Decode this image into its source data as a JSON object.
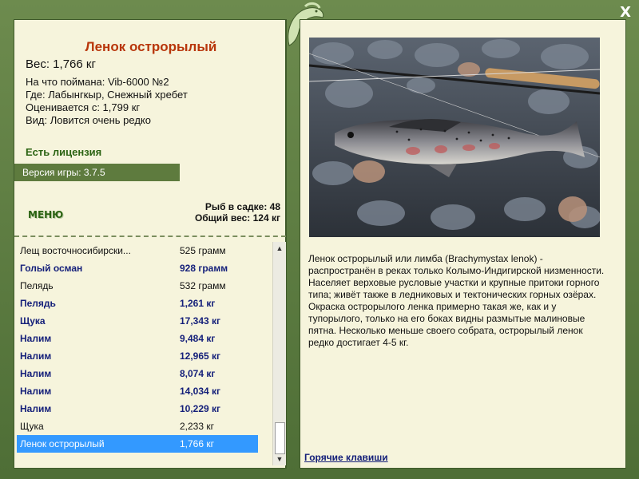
{
  "fish": {
    "title": "Ленок острорылый",
    "weight": "Вес: 1,766 кг",
    "caught_on": "На что поймана: Vib-6000 №2",
    "location": "Где: Лабынгкыр, Снежный хребет",
    "valued_from": "Оценивается с: 1,799 кг",
    "rarity": "Вид: Ловится очень редко"
  },
  "license": "Есть лицензия",
  "version": "Версия игры: 3.7.5",
  "menu_label": "МЕНЮ",
  "keepnet": {
    "count": "Рыб в садке: 48",
    "total": "Общий вес: 124 кг"
  },
  "catch_list": [
    {
      "name": "Лещ восточносибирски...",
      "weight": "525 грамм",
      "style": "normal"
    },
    {
      "name": "Голый осман",
      "weight": "928 грамм",
      "style": "bold"
    },
    {
      "name": "Пелядь",
      "weight": "532 грамм",
      "style": "normal"
    },
    {
      "name": "Пелядь",
      "weight": "1,261 кг",
      "style": "bold"
    },
    {
      "name": "Щука",
      "weight": "17,343 кг",
      "style": "bold"
    },
    {
      "name": "Налим",
      "weight": "9,484 кг",
      "style": "bold"
    },
    {
      "name": "Налим",
      "weight": "12,965 кг",
      "style": "bold"
    },
    {
      "name": "Налим",
      "weight": "8,074 кг",
      "style": "bold"
    },
    {
      "name": "Налим",
      "weight": "14,034 кг",
      "style": "bold"
    },
    {
      "name": "Налим",
      "weight": "10,229 кг",
      "style": "bold"
    },
    {
      "name": "Щука",
      "weight": "2,233 кг",
      "style": "normal"
    },
    {
      "name": "Ленок острорылый",
      "weight": "1,766 кг",
      "style": "selected"
    }
  ],
  "description": "Ленок острорылый или лимба (Brachymystax lenok) - распространён в реках только Колымо-Индигирской низменности. Населяет верховые русловые участки и крупные притоки горного типа; живёт также в ледниковых и тектонических горных озёрах. Окраска острорылого ленка примерно такая же, как и у тупорылого, только на его боках видны размытые малиновые пятна. Несколько меньше своего собрата, острорылый ленок редко достигает 4-5 кг.",
  "hotkeys_label": "Горячие клавиши",
  "close_label": "X",
  "icons": {
    "close": "close-icon",
    "logo": "leaf-fish-logo-icon",
    "scroll_up": "arrow-up-icon",
    "scroll_down": "arrow-down-icon"
  },
  "colors": {
    "frame": "#5a7a3f",
    "panel": "#f6f4dc",
    "title": "#b8360b",
    "selected": "#3399ff",
    "bold_text": "#15207a"
  }
}
